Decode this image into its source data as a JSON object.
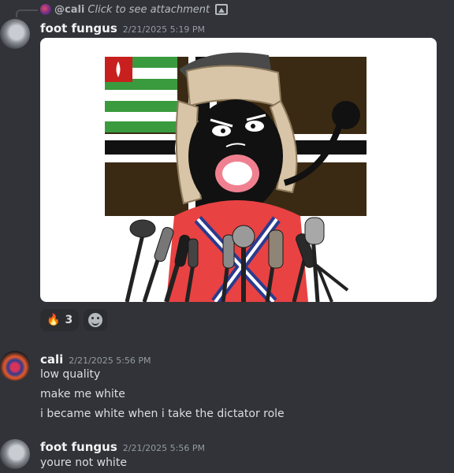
{
  "reply": {
    "mention": "@cali",
    "text": "Click to see attachment",
    "attachment_icon": "image-icon"
  },
  "messages": [
    {
      "author": "foot fungus",
      "timestamp": "2/21/2025 5:19 PM",
      "attachment": "image",
      "reactions": [
        {
          "emoji": "fire",
          "count": "3"
        },
        {
          "emoji": "add-reaction-icon"
        }
      ]
    },
    {
      "author": "cali",
      "timestamp": "2/21/2025 5:56 PM",
      "lines": [
        "low quality",
        "make me white",
        "i became white when i take the dictator role"
      ]
    },
    {
      "author": "foot fungus",
      "timestamp": "2/21/2025 5:56 PM",
      "lines": [
        "youre not white"
      ]
    }
  ],
  "colors": {
    "background": "#313338",
    "username": "#f2f3f5",
    "timestamp": "#949ba4",
    "text": "#dbdee1"
  }
}
